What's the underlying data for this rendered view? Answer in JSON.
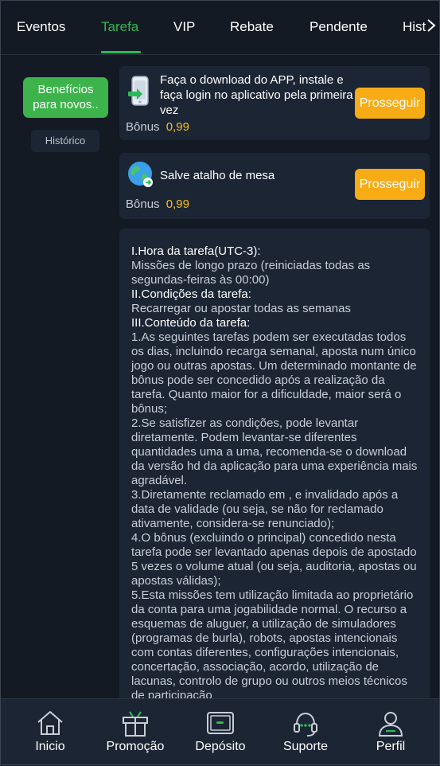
{
  "tabs": [
    {
      "label": "Eventos"
    },
    {
      "label": "Tarefa"
    },
    {
      "label": "VIP"
    },
    {
      "label": "Rebate"
    },
    {
      "label": "Pendente"
    },
    {
      "label": "Hist"
    }
  ],
  "active_tab": "Tarefa",
  "sidebar": {
    "benefits_line1": "Benefícios",
    "benefits_line2": "para novos..",
    "history": "Histórico"
  },
  "tasks": [
    {
      "title": "Faça o download do APP, instale e faça login no aplicativo pela primeira vez",
      "bonus_label": "Bônus",
      "bonus_value": "0,99",
      "button": "Prosseguir",
      "icon": "download-app-icon"
    },
    {
      "title": "Salve atalho de mesa",
      "bonus_label": "Bônus",
      "bonus_value": "0,99",
      "button": "Prosseguir",
      "icon": "globe-shortcut-icon"
    }
  ],
  "rules": {
    "h1": "I.Hora da tarefa(UTC-3):",
    "p1": "Missões de longo prazo (reiniciadas todas as segundas-feiras às 00:00)",
    "h2": "II.Condições da tarefa:",
    "p2": "Recarregar ou apostar todas as semanas",
    "h3": "III.Conteúdo da tarefa:",
    "p3": "1.As seguintes tarefas podem ser executadas todos os dias, incluindo recarga semanal, aposta num único jogo ou outras apostas. Um determinado montante de bônus pode ser concedido após a realização da tarefa. Quanto maior for a dificuldade, maior será o bônus;",
    "p4": "2.Se satisfizer as condições, pode levantar diretamente. Podem levantar-se diferentes quantidades uma a uma, recomenda-se o download da versão hd da aplicação para uma experiência mais agradável.",
    "p5": "3.Diretamente reclamado em , e invalidado após a data de validade (ou seja, se não for reclamado ativamente, considera-se renunciado);",
    "p6": "4.O bônus (excluindo o principal) concedido nesta tarefa pode ser levantado apenas depois de apostado 5 vezes o volume atual (ou seja, auditoria, apostas ou apostas válidas);",
    "p7": "5.Esta missões tem utilização limitada ao proprietário da conta para uma jogabilidade normal. O recurso a esquemas de aluguer, a utilização de simuladores (programas de burla), robots, apostas intencionais com contas diferentes, configurações intencionais, concertação, associação, acordo, utilização de lacunas, controlo de grupo ou outros meios técnicos de participação"
  },
  "bottom_nav": [
    {
      "label": "Inicio",
      "icon": "home-icon"
    },
    {
      "label": "Promoção",
      "icon": "gift-icon"
    },
    {
      "label": "Depósito",
      "icon": "wallet-icon"
    },
    {
      "label": "Suporte",
      "icon": "headset-icon"
    },
    {
      "label": "Perfil",
      "icon": "user-icon"
    }
  ],
  "colors": {
    "background": "#131a24",
    "card": "#1c2533",
    "accent_green": "#2eb855",
    "button_orange": "#f7ac16",
    "bonus_yellow": "#f6c023"
  }
}
